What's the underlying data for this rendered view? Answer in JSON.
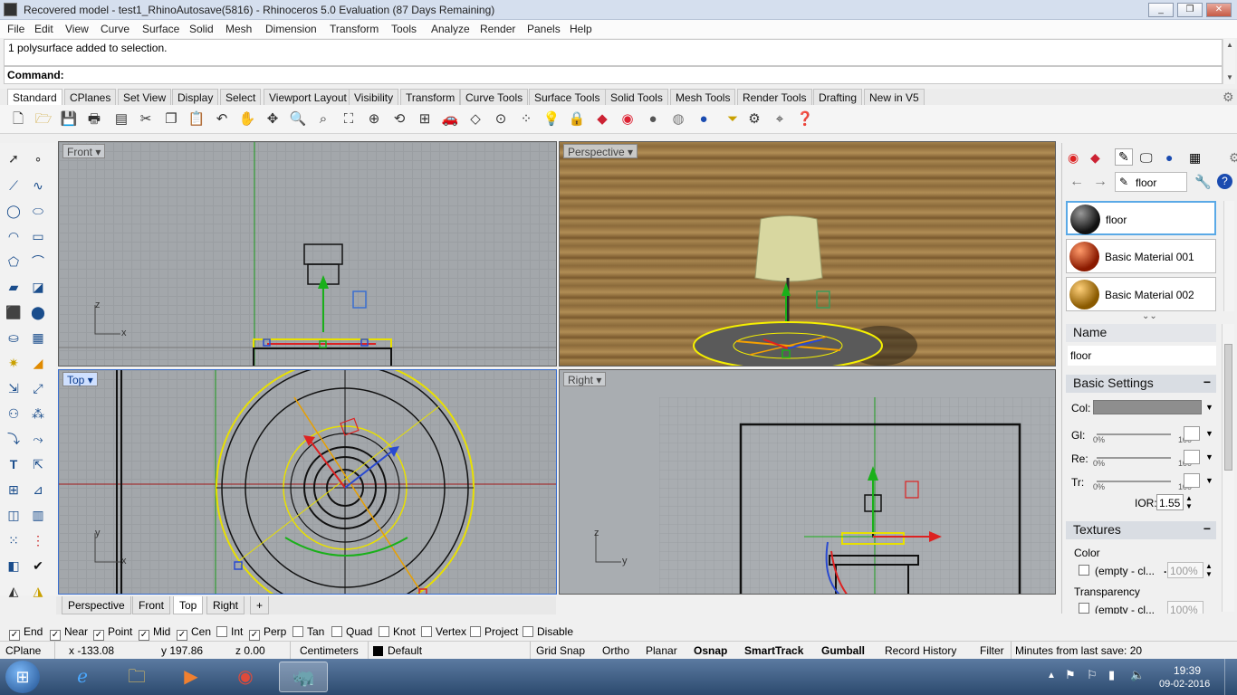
{
  "window": {
    "title": "Recovered model - test1_RhinoAutosave(5816) - Rhinoceros 5.0 Evaluation (87 Days Remaining)",
    "minimize": "_",
    "maximize": "❐",
    "close": "✕"
  },
  "menu": [
    "File",
    "Edit",
    "View",
    "Curve",
    "Surface",
    "Solid",
    "Mesh",
    "Dimension",
    "Transform",
    "Tools",
    "Analyze",
    "Render",
    "Panels",
    "Help"
  ],
  "command": {
    "history": "1 polysurface added to selection.",
    "prompt": "Command:"
  },
  "tabs": [
    "Standard",
    "CPlanes",
    "Set View",
    "Display",
    "Select",
    "Viewport Layout",
    "Visibility",
    "Transform",
    "Curve Tools",
    "Surface Tools",
    "Solid Tools",
    "Mesh Tools",
    "Render Tools",
    "Drafting",
    "New in V5"
  ],
  "viewports": {
    "front": "Front",
    "perspective": "Perspective",
    "top": "Top",
    "right": "Right",
    "axis_x": "x",
    "axis_y": "y",
    "axis_z": "z"
  },
  "viewport_tabs": [
    "Perspective",
    "Front",
    "Top",
    "Right"
  ],
  "viewport_tab_add": "+",
  "panel": {
    "search_value": "floor",
    "materials": [
      {
        "name": "floor",
        "color": "#2a2a2a"
      },
      {
        "name": "Basic Material 001",
        "color": "#b83a1a"
      },
      {
        "name": "Basic Material 002",
        "color": "#c88a2a"
      }
    ],
    "name_header": "Name",
    "name_value": "floor",
    "basic_settings": "Basic Settings",
    "col_label": "Col:",
    "gl_label": "Gl:",
    "re_label": "Re:",
    "tr_label": "Tr:",
    "pct0": "0%",
    "pct100": "100",
    "ior_label": "IOR:",
    "ior_value": "1.55",
    "textures": "Textures",
    "color_label": "Color",
    "empty1": "(empty - cl...",
    "dots": "...",
    "pct_100": "100%",
    "transparency_label": "Transparency",
    "empty2": "(empty - cl...",
    "collapse": "−"
  },
  "osnaps": [
    {
      "label": "End",
      "checked": true
    },
    {
      "label": "Near",
      "checked": true
    },
    {
      "label": "Point",
      "checked": true
    },
    {
      "label": "Mid",
      "checked": true
    },
    {
      "label": "Cen",
      "checked": true
    },
    {
      "label": "Int",
      "checked": false
    },
    {
      "label": "Perp",
      "checked": true
    },
    {
      "label": "Tan",
      "checked": false
    },
    {
      "label": "Quad",
      "checked": false
    },
    {
      "label": "Knot",
      "checked": false
    },
    {
      "label": "Vertex",
      "checked": false
    },
    {
      "label": "Project",
      "checked": false
    },
    {
      "label": "Disable",
      "checked": false
    }
  ],
  "status": {
    "cplane": "CPlane",
    "x": "x -133.08",
    "y": "y 197.86",
    "z": "z 0.00",
    "units": "Centimeters",
    "layer": "Default",
    "grid_snap": "Grid Snap",
    "ortho": "Ortho",
    "planar": "Planar",
    "osnap": "Osnap",
    "smarttrack": "SmartTrack",
    "gumball": "Gumball",
    "record_history": "Record History",
    "filter": "Filter",
    "minutes": "Minutes from last save: 20"
  },
  "taskbar": {
    "time": "19:39",
    "date": "09-02-2016"
  },
  "colors": {
    "accent": "#3a6fd0",
    "viewport_bg": "#a3a7ab",
    "wood": "#9a7844",
    "selection": "#f5f000"
  }
}
